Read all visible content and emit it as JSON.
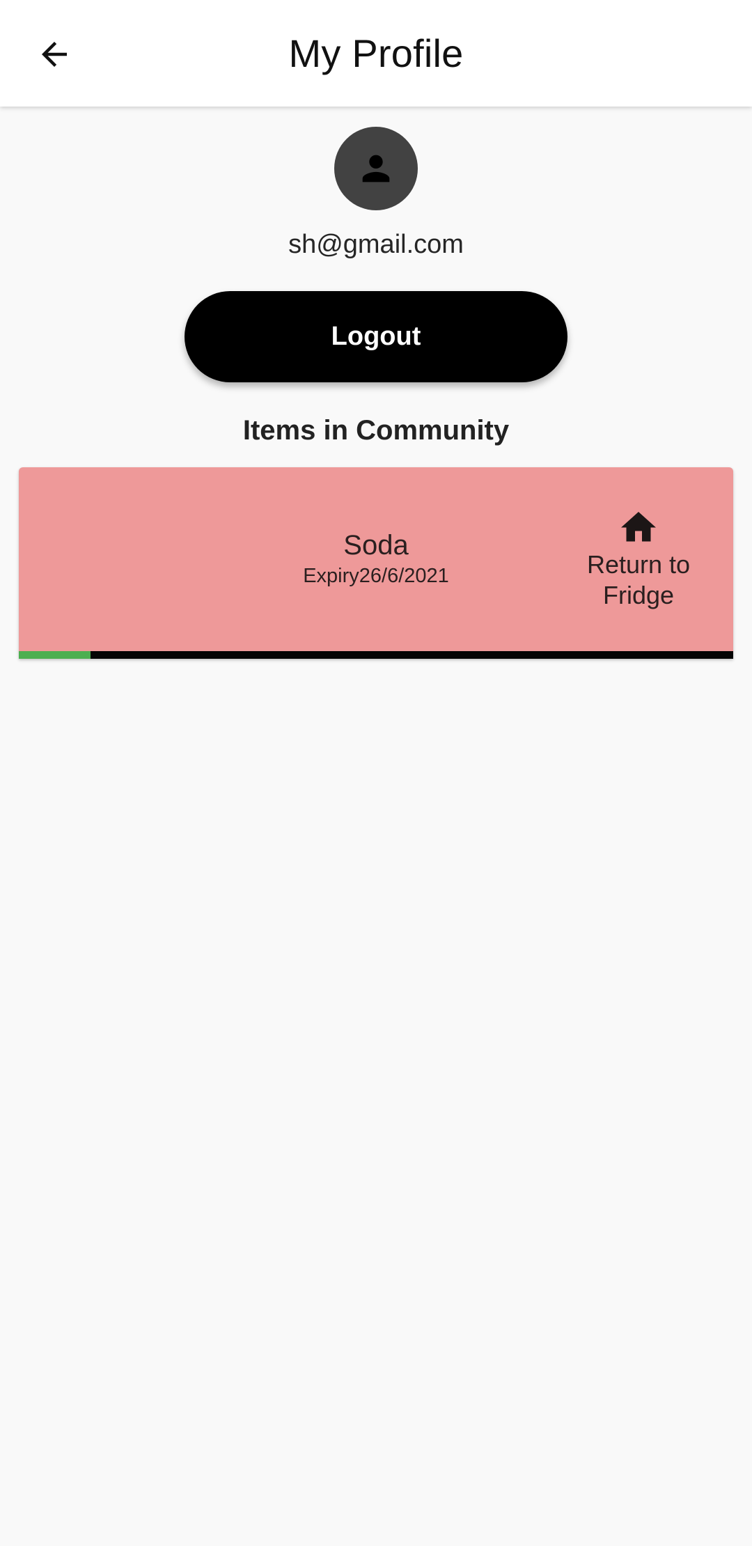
{
  "appbar": {
    "title": "My Profile",
    "back_icon": "arrow-back-icon"
  },
  "profile": {
    "avatar_icon": "person-icon",
    "email": "sh@gmail.com",
    "logout_label": "Logout"
  },
  "community": {
    "section_title": "Items in Community",
    "items": [
      {
        "name": "Soda",
        "expiry": "Expiry26/6/2021",
        "action_icon": "home-icon",
        "action_label": "Return to\nFridge",
        "freshness_fraction": 0.1,
        "card_color": "#ee9999",
        "progress_color": "#4caf50",
        "track_color": "#050505"
      }
    ]
  },
  "colors": {
    "background": "#f9f9f9",
    "appbar": "#ffffff",
    "button": "#000000",
    "avatar": "#424242"
  }
}
